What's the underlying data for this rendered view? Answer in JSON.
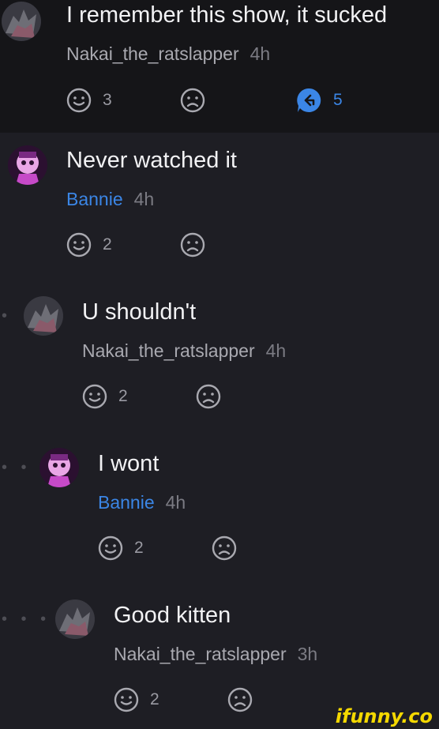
{
  "colors": {
    "background": "#1e1e24",
    "highlight_band": "#151518",
    "accent_blue": "#3b86e6",
    "watermark": "#f4d800"
  },
  "comments": [
    {
      "text": "I remember this show, it sucked",
      "author": "Nakai_the_ratslapper",
      "time": "4h",
      "likes": "3",
      "replies": "5",
      "avatar": "dragon-avatar"
    },
    {
      "text": "Never watched it",
      "author": "Bannie",
      "time": "4h",
      "likes": "2",
      "avatar": "purple-character-avatar"
    },
    {
      "text": "U shouldn't",
      "author": "Nakai_the_ratslapper",
      "time": "4h",
      "likes": "2",
      "avatar": "dragon-avatar"
    },
    {
      "text": "I wont",
      "author": "Bannie",
      "time": "4h",
      "likes": "2",
      "avatar": "purple-character-avatar"
    },
    {
      "text": "Good kitten",
      "author": "Nakai_the_ratslapper",
      "time": "3h",
      "likes": "2",
      "avatar": "dragon-avatar"
    }
  ],
  "thread_dots": [
    "•",
    "• •",
    "• • •"
  ],
  "watermark": "ifunny.co"
}
